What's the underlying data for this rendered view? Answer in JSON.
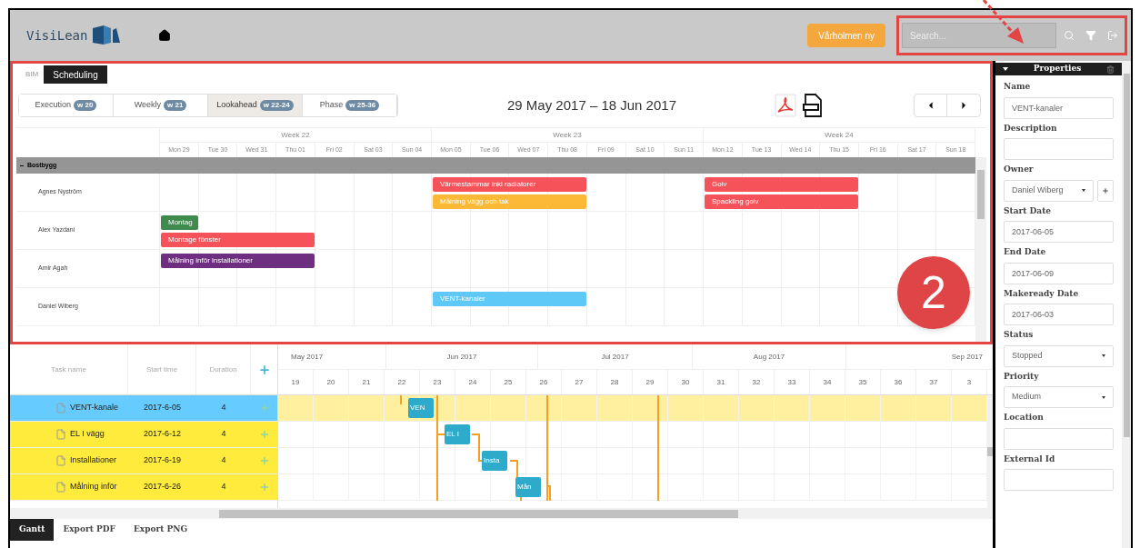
{
  "header": {
    "logo": "VisiLean",
    "project_button": "Vårholmen ny",
    "search": {
      "placeholder": "Search..."
    }
  },
  "scheduler": {
    "tabs": [
      {
        "label": "BIM",
        "selected": false
      },
      {
        "label": "Scheduling",
        "selected": true
      }
    ],
    "views": [
      {
        "label": "Execution",
        "badge": "w 20",
        "selected": false
      },
      {
        "label": "Weekly",
        "badge": "w 21",
        "selected": false
      },
      {
        "label": "Lookahead",
        "badge": "w 22-24",
        "selected": true
      },
      {
        "label": "Phase",
        "badge": "w 25-36",
        "selected": false
      }
    ],
    "date_range": "29 May 2017 – 18 Jun 2017",
    "weeks": [
      "Week 22",
      "Week 23",
      "Week 24"
    ],
    "days": [
      "Mon 29",
      "Tue 30",
      "Wed 31",
      "Thu 01",
      "Fri 02",
      "Sat 03",
      "Sun 04",
      "Mon 05",
      "Tue 06",
      "Wed 07",
      "Thu 08",
      "Fri 09",
      "Sat 10",
      "Sun 11",
      "Mon 12",
      "Tue 13",
      "Wed 14",
      "Thu 15",
      "Fri 16",
      "Sat 17",
      "Sun 18"
    ],
    "group": {
      "name": "Bostbygg"
    },
    "resources": [
      {
        "name": "Agnes Nyström",
        "tasks": [
          {
            "name": "Värmestammar inkl radiatorer",
            "color": "#f5525a"
          },
          {
            "name": "Målning vägg och tak",
            "color": "#fbb936"
          },
          {
            "name": "Golv",
            "color": "#f5525a"
          },
          {
            "name": "Spackling golv",
            "color": "#f5525a"
          }
        ]
      },
      {
        "name": "Alex Yazdani",
        "tasks": [
          {
            "name": "Montag",
            "color": "#3f8a4c"
          },
          {
            "name": "Montage fönster",
            "color": "#f5525a"
          }
        ]
      },
      {
        "name": "Amir Agah",
        "tasks": [
          {
            "name": "Målning inför installationer",
            "color": "#6e2f80"
          }
        ]
      },
      {
        "name": "Daniel Wiberg",
        "tasks": [
          {
            "name": "VENT-kanaler",
            "color": "#5ec8f7"
          }
        ]
      }
    ],
    "callout": "2"
  },
  "gantt": {
    "columns": [
      "Task name",
      "Start time",
      "Duration"
    ],
    "months": [
      "May 2017",
      "Jun 2017",
      "Jul 2017",
      "Aug 2017",
      "Sep 2017"
    ],
    "weeks": [
      "19",
      "20",
      "21",
      "22",
      "23",
      "24",
      "25",
      "26",
      "27",
      "28",
      "29",
      "30",
      "31",
      "32",
      "33",
      "34",
      "35",
      "36",
      "37",
      "3"
    ],
    "tasks": [
      {
        "name": "VENT-kanale",
        "start": "2017-6-05",
        "duration": "4",
        "bar_label": "VEN",
        "selected": true
      },
      {
        "name": "EL I vägg",
        "start": "2017-6-12",
        "duration": "4",
        "bar_label": "EL I",
        "selected": false
      },
      {
        "name": "Installationer",
        "start": "2017-6-19",
        "duration": "4",
        "bar_label": "Insta",
        "selected": false
      },
      {
        "name": "Målning inför",
        "start": "2017-6-26",
        "duration": "4",
        "bar_label": "Mån",
        "selected": false
      }
    ],
    "tabs": [
      {
        "label": "Gantt",
        "selected": true
      },
      {
        "label": "Export PDF",
        "selected": false
      },
      {
        "label": "Export PNG",
        "selected": false
      }
    ]
  },
  "properties": {
    "title": "Properties",
    "fields": [
      {
        "kind": "text",
        "label": "Name",
        "value": "VENT-kanaler"
      },
      {
        "kind": "text",
        "label": "Description"
      },
      {
        "kind": "select",
        "label": "Owner",
        "value": "Daniel Wiberg",
        "add": true
      },
      {
        "kind": "text",
        "label": "Start Date",
        "value": "2017-06-05"
      },
      {
        "kind": "text",
        "label": "End Date",
        "value": "2017-06-09"
      },
      {
        "kind": "text",
        "label": "Makeready Date",
        "value": "2017-06-03"
      },
      {
        "kind": "select",
        "label": "Status",
        "value": "Stopped"
      },
      {
        "kind": "select",
        "label": "Priority",
        "value": "Medium"
      },
      {
        "kind": "text",
        "label": "Location"
      },
      {
        "kind": "text",
        "label": "External Id"
      }
    ]
  }
}
